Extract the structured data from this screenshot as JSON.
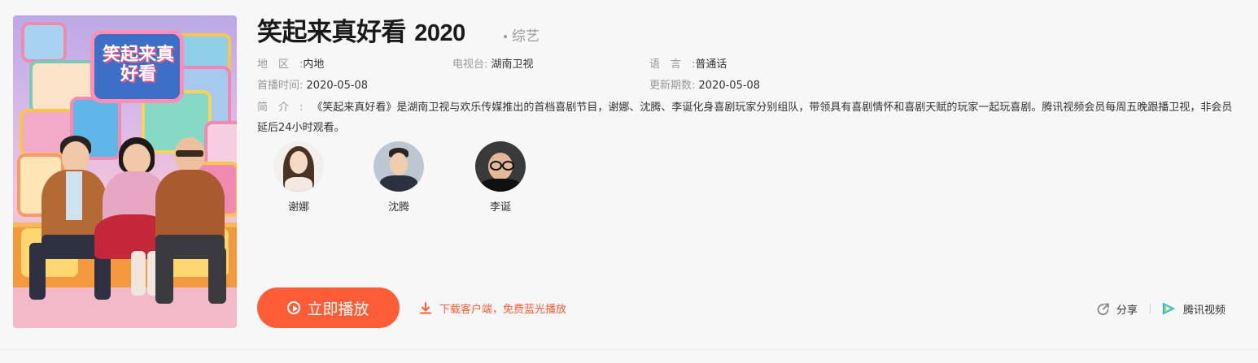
{
  "show": {
    "title": "笑起来真好看",
    "year": "2020",
    "category": "综艺",
    "poster_logo": "笑起来真好看"
  },
  "meta": {
    "region_label": "地区:",
    "region": "内地",
    "station_label": "电视台:",
    "station": "湖南卫视",
    "language_label": "语言:",
    "language": "普通话",
    "premiere_label": "首播时间:",
    "premiere": "2020-05-08",
    "update_label": "更新期数:",
    "update": "2020-05-08"
  },
  "description": {
    "label": "简介:",
    "text": "《笑起来真好看》是湖南卫视与欢乐传媒推出的首档喜剧节目，谢娜、沈腾、李诞化身喜剧玩家分别组队，带领具有喜剧情怀和喜剧天赋的玩家一起玩喜剧。腾讯视频会员每周五晚跟播卫视，非会员延后24小时观看。"
  },
  "cast": [
    {
      "name": "谢娜"
    },
    {
      "name": "沈腾"
    },
    {
      "name": "李诞"
    }
  ],
  "actions": {
    "play_label": "立即播放",
    "download_label": "下载客户端，免费蓝光播放",
    "share_label": "分享",
    "platform_label": "腾讯视频"
  },
  "colors": {
    "accent": "#ff5c38",
    "background": "#f7f7f7"
  }
}
